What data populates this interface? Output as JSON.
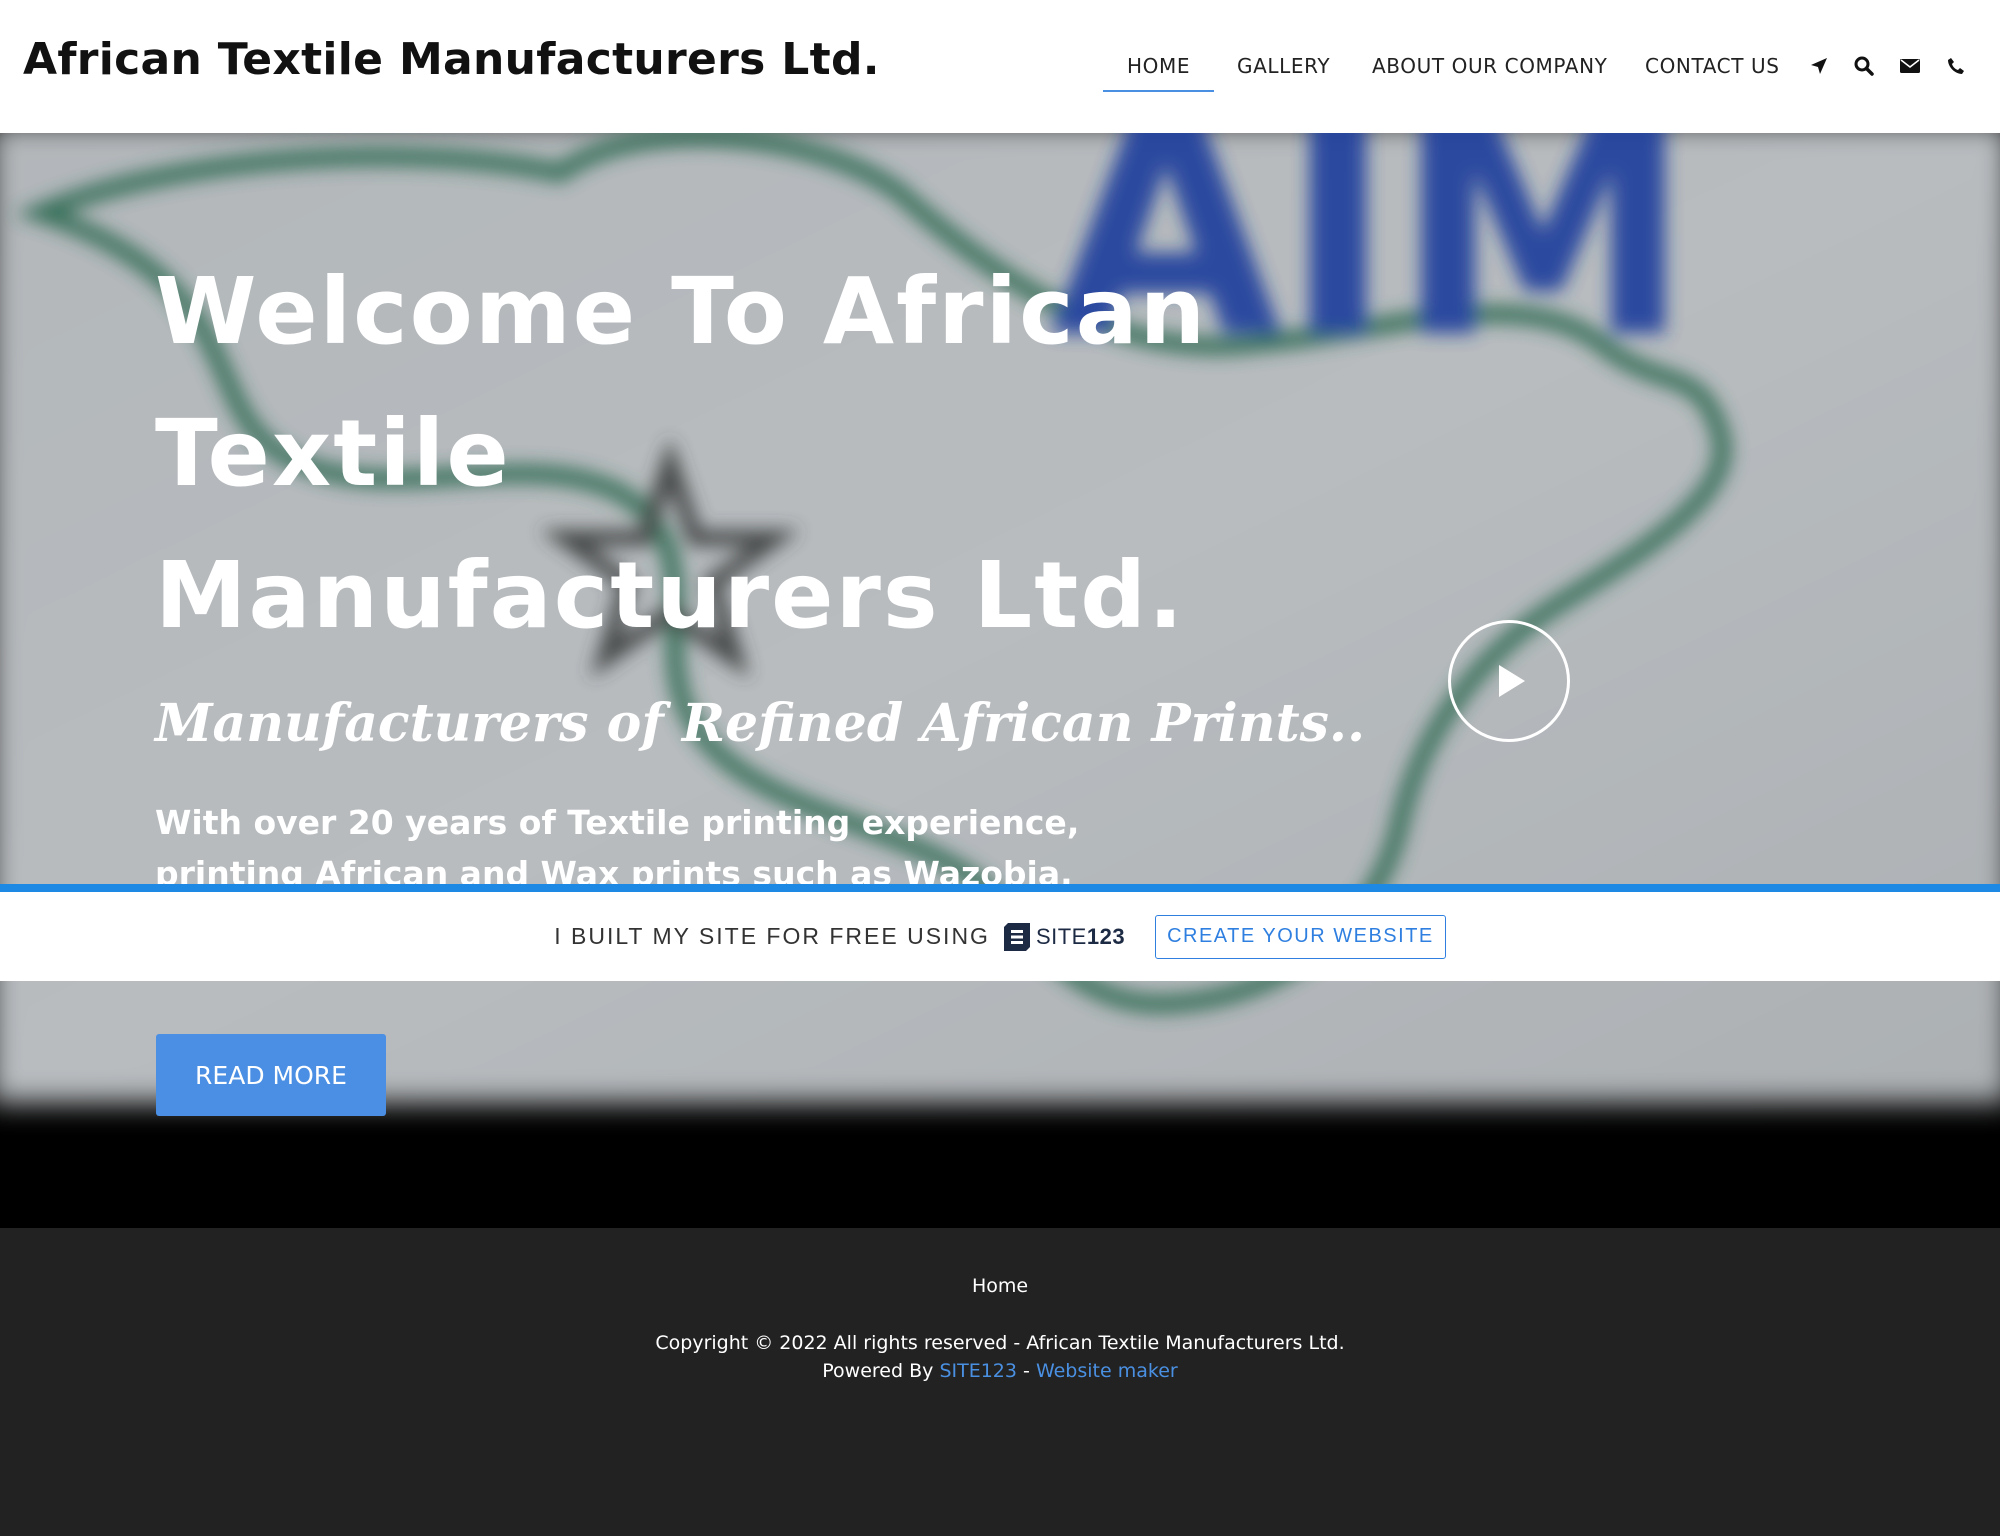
{
  "header": {
    "brand": "African Textile Manufacturers Ltd.",
    "nav": [
      {
        "label": "HOME",
        "active": true
      },
      {
        "label": "GALLERY",
        "active": false
      },
      {
        "label": "ABOUT OUR COMPANY",
        "active": false
      },
      {
        "label": "CONTACT US",
        "active": false
      }
    ],
    "icons": [
      "location-arrow-icon",
      "search-icon",
      "envelope-icon",
      "phone-icon"
    ]
  },
  "hero": {
    "title_lines": [
      "Welcome To African",
      "Textile",
      "Manufacturers Ltd."
    ],
    "subtitle": "Manufacturers of Refined African Prints..",
    "text": "With over 20 years of Textile printing experience, printing African and Wax prints such as Wazobia, Festac, Standard Organization of Nigeria (SON).",
    "read_more_label": "READ MORE",
    "background_logo_text": "AIM"
  },
  "promo": {
    "text": "I BUILT MY SITE FOR FREE USING",
    "logo_text": "SITE",
    "logo_number": "123",
    "button_label": "CREATE YOUR WEBSITE"
  },
  "footer": {
    "home_link": "Home",
    "copyright": "Copyright © 2022 All rights reserved - African Textile Manufacturers Ltd.",
    "powered_by": "Powered By",
    "site123_link": "SITE123",
    "separator": "-",
    "website_maker_link": "Website maker"
  },
  "colors": {
    "accent": "#4a8fe4",
    "promo_border": "#1e88e5",
    "footer_bg": "#222222",
    "map_outline": "#2f6a52",
    "logo_blue": "#1a3d9c"
  }
}
